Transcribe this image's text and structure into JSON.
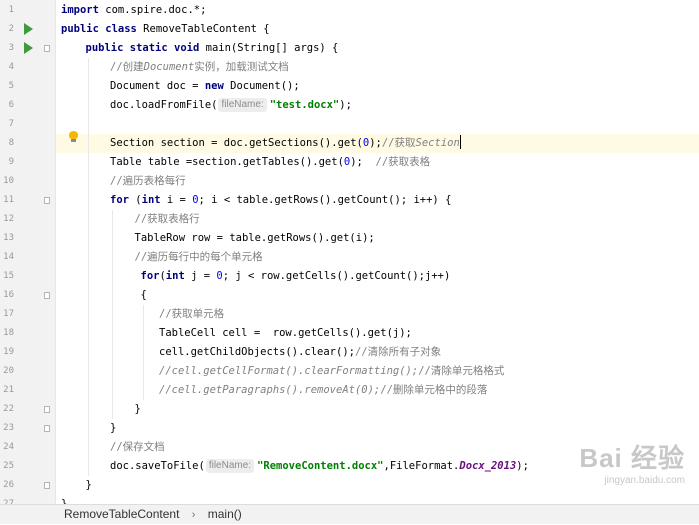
{
  "colors": {
    "keyword": "#000080",
    "comment": "#808080",
    "string": "#008000",
    "number": "#0000ff",
    "static_field": "#660e7a",
    "current_line": "#fffae3",
    "run_marker": "#3d9a3d",
    "intention_bulb": "#f5b800"
  },
  "editor": {
    "lines": [
      {
        "n": "1",
        "indent": 0,
        "tokens": [
          {
            "t": "import",
            "k": "kw"
          },
          {
            "t": " com.spire.doc.*;"
          }
        ]
      },
      {
        "n": "2",
        "indent": 0,
        "tokens": [
          {
            "t": "public class",
            "k": "kw"
          },
          {
            "t": " RemoveTableContent {"
          }
        ]
      },
      {
        "n": "3",
        "indent": 1,
        "tokens": [
          {
            "t": "public static void",
            "k": "kw"
          },
          {
            "t": " main(String[] args) {"
          }
        ]
      },
      {
        "n": "4",
        "indent": 2,
        "tokens": [
          {
            "t": "//创建",
            "k": "cm"
          },
          {
            "t": "Document",
            "k": "cmi"
          },
          {
            "t": "实例，加载测试文档",
            "k": "cm"
          }
        ]
      },
      {
        "n": "5",
        "indent": 2,
        "tokens": [
          {
            "t": "Document doc = "
          },
          {
            "t": "new",
            "k": "kw"
          },
          {
            "t": " Document();"
          }
        ]
      },
      {
        "n": "6",
        "indent": 2,
        "tokens": [
          {
            "t": "doc.loadFromFile("
          },
          {
            "t": "fileName:",
            "k": "hint"
          },
          {
            "t": "\"test.docx\"",
            "k": "str"
          },
          {
            "t": ");"
          }
        ]
      },
      {
        "n": "7",
        "indent": 0,
        "tokens": []
      },
      {
        "n": "8",
        "indent": 2,
        "current": true,
        "tokens": [
          {
            "t": "Section section = doc.getSections().get("
          },
          {
            "t": "0",
            "k": "num"
          },
          {
            "t": ");"
          },
          {
            "t": "//获取",
            "k": "cm"
          },
          {
            "t": "Section",
            "k": "cmi"
          },
          {
            "t": "",
            "k": "caret"
          }
        ]
      },
      {
        "n": "9",
        "indent": 2,
        "tokens": [
          {
            "t": "Table table =section.getTables().get("
          },
          {
            "t": "0",
            "k": "num"
          },
          {
            "t": ");  "
          },
          {
            "t": "//获取表格",
            "k": "cm"
          }
        ]
      },
      {
        "n": "10",
        "indent": 2,
        "tokens": [
          {
            "t": "//遍历表格每行",
            "k": "cm"
          }
        ]
      },
      {
        "n": "11",
        "indent": 2,
        "tokens": [
          {
            "t": "for",
            "k": "kw"
          },
          {
            "t": " ("
          },
          {
            "t": "int",
            "k": "kw"
          },
          {
            "t": " i = "
          },
          {
            "t": "0",
            "k": "num"
          },
          {
            "t": "; i < table.getRows().getCount(); i++) {"
          }
        ]
      },
      {
        "n": "12",
        "indent": 3,
        "tokens": [
          {
            "t": "//获取表格行",
            "k": "cm"
          }
        ]
      },
      {
        "n": "13",
        "indent": 3,
        "tokens": [
          {
            "t": "TableRow row = table.getRows().get(i);"
          }
        ]
      },
      {
        "n": "14",
        "indent": 3,
        "tokens": [
          {
            "t": "//遍历每行中的每个单元格",
            "k": "cm"
          }
        ]
      },
      {
        "n": "15",
        "indent": 3,
        "offset": 6,
        "tokens": [
          {
            "t": "for",
            "k": "kw"
          },
          {
            "t": "("
          },
          {
            "t": "int",
            "k": "kw"
          },
          {
            "t": " j = "
          },
          {
            "t": "0",
            "k": "num"
          },
          {
            "t": "; j < row.getCells().getCount();j++)"
          }
        ]
      },
      {
        "n": "16",
        "indent": 3,
        "offset": 6,
        "tokens": [
          {
            "t": "{"
          }
        ]
      },
      {
        "n": "17",
        "indent": 4,
        "tokens": [
          {
            "t": "//获取单元格",
            "k": "cm"
          }
        ]
      },
      {
        "n": "18",
        "indent": 4,
        "tokens": [
          {
            "t": "TableCell cell =  row.getCells().get(j);"
          }
        ]
      },
      {
        "n": "19",
        "indent": 4,
        "tokens": [
          {
            "t": "cell.getChildObjects().clear();"
          },
          {
            "t": "//清除所有子对象",
            "k": "cm"
          }
        ]
      },
      {
        "n": "20",
        "indent": 4,
        "tokens": [
          {
            "t": "//cell.getCellFormat().clearFormatting();",
            "k": "cmi"
          },
          {
            "t": "//清除单元格格式",
            "k": "cm"
          }
        ]
      },
      {
        "n": "21",
        "indent": 4,
        "tokens": [
          {
            "t": "//cell.getParagraphs().removeAt(0);",
            "k": "cmi"
          },
          {
            "t": "//删除单元格中的段落",
            "k": "cm"
          }
        ]
      },
      {
        "n": "22",
        "indent": 3,
        "tokens": [
          {
            "t": "}"
          }
        ]
      },
      {
        "n": "23",
        "indent": 2,
        "tokens": [
          {
            "t": "}"
          }
        ]
      },
      {
        "n": "24",
        "indent": 2,
        "tokens": [
          {
            "t": "//保存文档",
            "k": "cm"
          }
        ]
      },
      {
        "n": "25",
        "indent": 2,
        "tokens": [
          {
            "t": "doc.saveToFile("
          },
          {
            "t": "fileName:",
            "k": "hint"
          },
          {
            "t": "\"RemoveContent.docx\"",
            "k": "str"
          },
          {
            "t": ",FileFormat."
          },
          {
            "t": "Docx_2013",
            "k": "fld"
          },
          {
            "t": ");"
          }
        ]
      },
      {
        "n": "26",
        "indent": 1,
        "tokens": [
          {
            "t": "}"
          }
        ]
      },
      {
        "n": "27",
        "indent": 0,
        "tokens": [
          {
            "t": "}"
          }
        ]
      }
    ],
    "run_markers": [
      "2",
      "3"
    ],
    "fold_markers": [
      "3",
      "11",
      "16",
      "22",
      "23",
      "26"
    ],
    "intention_bulb_line": "8"
  },
  "breadcrumb": {
    "items": [
      "RemoveTableContent",
      "main()"
    ]
  },
  "watermark": {
    "main": "Bai 经验",
    "sub": "jingyan.baidu.com"
  }
}
